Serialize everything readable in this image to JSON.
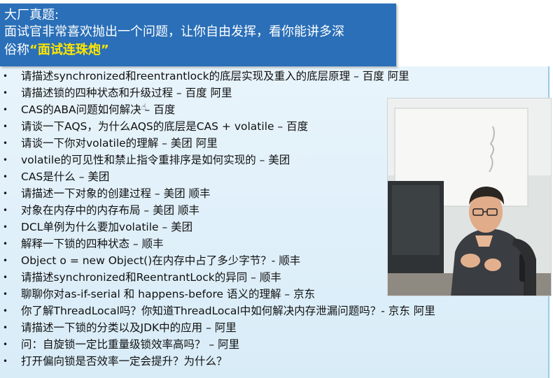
{
  "header": {
    "line1": "大厂真题:",
    "line2": "面试官非常喜欢抛出一个问题，让你自由发挥，看你能讲多深",
    "line3_prefix": "俗称",
    "line3_highlight": "“面试连珠炮”"
  },
  "bullet_glyph": "•",
  "questions": [
    "请描述synchronized和reentrantlock的底层实现及重入的底层原理 – 百度 阿里",
    "请描述锁的四种状态和升级过程 – 百度 阿里",
    "CAS的ABA问题如何解决 – 百度",
    "请谈一下AQS，为什么AQS的底层是CAS + volatile – 百度",
    "请谈一下你对volatile的理解 – 美团 阿里",
    "volatile的可见性和禁止指令重排序是如何实现的 – 美团",
    "CAS是什么 – 美团",
    "请描述一下对象的创建过程 – 美团 顺丰",
    "对象在内存中的内存布局 – 美团 顺丰",
    "DCL单例为什么要加volatile – 美团",
    "解释一下锁的四种状态 – 顺丰",
    "Object o = new Object()在内存中占了多少字节？- 顺丰",
    "请描述synchronized和ReentrantLock的异同 – 顺丰",
    "聊聊你对as-if-serial 和 happens-before 语义的理解 – 京东",
    "你了解ThreadLocal吗？你知道ThreadLocal中如何解决内存泄漏问题吗？- 京东 阿里",
    "请描述一下锁的分类以及JDK中的应用 – 阿里",
    "问：自旋锁一定比重量级锁效率高吗？ – 阿里",
    "打开偏向锁是否效率一定会提升？为什么？"
  ],
  "colors": {
    "header_bg": "#2a6fb8",
    "header_text": "#ffffff",
    "highlight": "#ffe600",
    "panel_bg": "#e8f4fb"
  }
}
